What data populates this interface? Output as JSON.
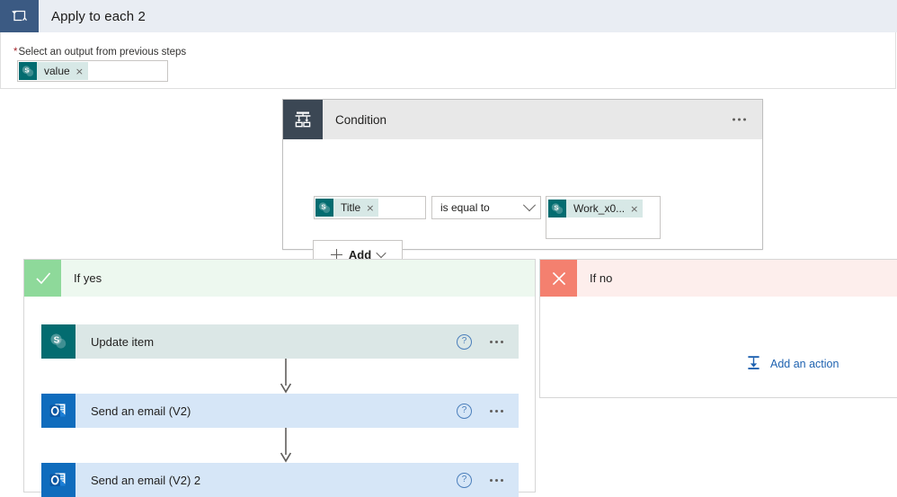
{
  "apply_to_each": {
    "icon": "loop-icon",
    "title": "Apply to each 2",
    "required_marker": "*",
    "output_label": "Select an output from previous steps",
    "output_token": {
      "icon": "sharepoint-icon",
      "label": "value",
      "remove": "×"
    }
  },
  "condition": {
    "icon": "condition-branch-icon",
    "title": "Condition",
    "overflow_menu": "...",
    "left_operand": {
      "icon": "sharepoint-icon",
      "label": "Title",
      "remove": "×"
    },
    "operator": {
      "value": "is equal to",
      "chevron": "chevron-down-icon"
    },
    "right_operand": {
      "icon": "sharepoint-icon",
      "label": "Work_x0...",
      "remove": "×"
    },
    "add_button": {
      "label": "Add",
      "plus": "plus-icon",
      "chevron": "chevron-down-icon"
    }
  },
  "branches": {
    "yes": {
      "icon": "checkmark-icon",
      "title": "If yes",
      "actions": [
        {
          "icon": "sharepoint-icon",
          "label": "Update item",
          "help": "?",
          "overflow_menu": "..."
        },
        {
          "icon": "outlook-icon",
          "label": "Send an email (V2)",
          "help": "?",
          "overflow_menu": "..."
        },
        {
          "icon": "outlook-icon",
          "label": "Send an email (V2) 2",
          "help": "?",
          "overflow_menu": "..."
        }
      ]
    },
    "no": {
      "icon": "close-x-icon",
      "title": "If no",
      "add_action": {
        "icon": "add-action-icon",
        "label": "Add an action"
      }
    }
  },
  "colors": {
    "apply_header_bg": "#e9edf3",
    "apply_icon_bg": "#3b5a83",
    "condition_icon_bg": "#3b4754",
    "condition_header_bg": "#e8e8e8",
    "yes_accent": "#8ed99a",
    "no_accent": "#f4806f",
    "yes_header_bg": "#edf8ef",
    "no_header_bg": "#fdeeec",
    "sharepoint_teal": "#036c70",
    "outlook_blue": "#0f6cbd",
    "link_blue": "#1e62b0",
    "required_red": "#a4262c",
    "token_bg": "#d7e8e6",
    "action_sp_bg": "#dbe7e6",
    "action_ol_bg": "#d6e6f7"
  }
}
